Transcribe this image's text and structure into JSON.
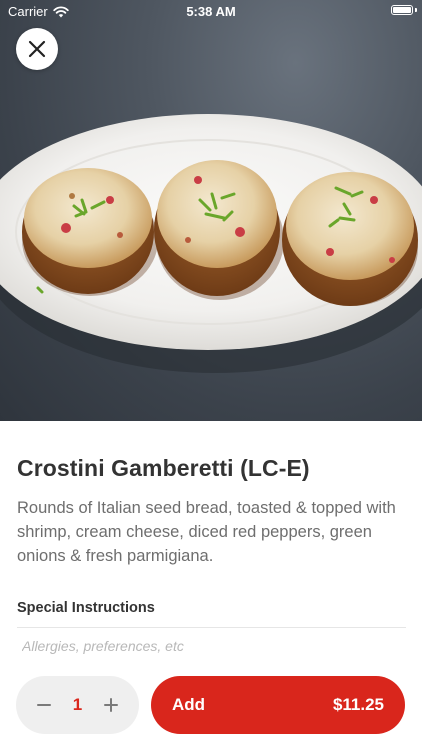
{
  "status_bar": {
    "carrier": "Carrier",
    "time": "5:38 AM",
    "wifi_icon": "wifi-icon",
    "battery_icon": "battery-icon"
  },
  "hero": {
    "description_icon": "crostini-photo"
  },
  "close_button": {
    "icon": "close-icon"
  },
  "item": {
    "title": "Crostini Gamberetti (LC-E)",
    "description": "Rounds of Italian seed bread, toasted & topped with shrimp, cream cheese, diced red peppers, green onions & fresh parmigiana."
  },
  "special_instructions": {
    "label": "Special Instructions",
    "placeholder": "Allergies, preferences, etc",
    "value": ""
  },
  "order": {
    "quantity": "1",
    "decrement_icon": "minus-icon",
    "increment_icon": "plus-icon",
    "add_label": "Add",
    "price": "$11.25"
  },
  "colors": {
    "accent": "#d9261c",
    "stepper_bg": "#efefef",
    "title_text": "#333333",
    "body_text": "#6e6e6e",
    "placeholder_text": "#b8b8b8"
  }
}
